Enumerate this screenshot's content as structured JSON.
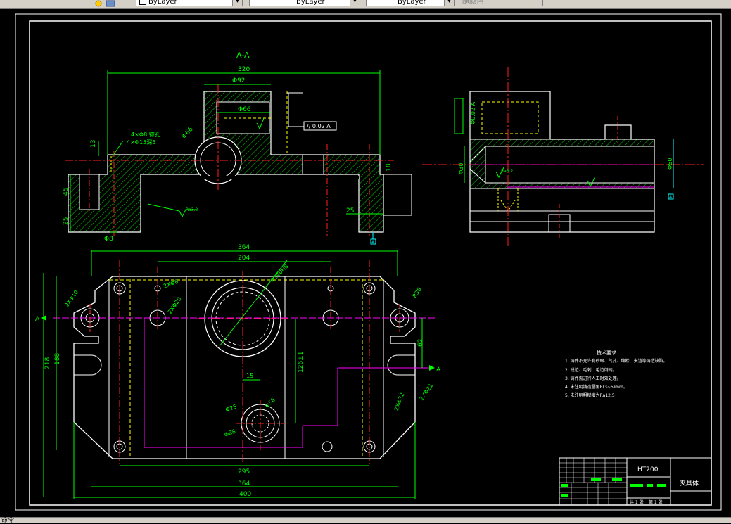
{
  "toolbar": {
    "layer_combo": "ByLayer",
    "linetype_combo": "ByLayer",
    "lineweight_combo": "ByLayer",
    "plotstyle_combo": "随颜色"
  },
  "drawing": {
    "section_title": "A-A",
    "section_marker": "A",
    "dims_top": {
      "d320": "320",
      "d92": "Φ92",
      "d66": "Φ66",
      "d66b": "Φ66",
      "d13": "13",
      "d45": "45",
      "d25a": "25",
      "d25b": "25",
      "d18": "18",
      "d8": "Φ8",
      "holes": "4×Φ8 锪孔",
      "holes2": "4×Φ15深5",
      "tol": "// 0.02 A",
      "rough": "Ra3.2"
    },
    "dims_plan": {
      "d364a": "364",
      "d204": "204",
      "d2x8": "2XΦ8",
      "d2x20": "2XΦ20",
      "d2x10": "2XΦ10",
      "d36": "R36",
      "d218": "218",
      "d188": "188",
      "d62": "62",
      "d126": "126±1",
      "d15": "15",
      "d25": "Φ25",
      "d56": "Φ56",
      "d88": "Φ88",
      "d2x32": "2XΦ32",
      "d2x21": "2XΦ21",
      "d295": "295",
      "d364b": "364",
      "d400": "400",
      "d140": "Φ140H8"
    },
    "dims_side": {
      "d30": "Φ30",
      "d50": "Φ50",
      "tol2": "Φ0.02 A",
      "rough": "Ra3.2"
    },
    "notes": {
      "heading": "技术要求",
      "lines": [
        "1. 铸件不允许有砂眼、气孔、缩松、夹渣等铸造缺陷。",
        "2. 锐边、毛刺、毛边倒钝。",
        "3. 铸件需进行人工时效处理。",
        "4. 未注明铸造圆角R(3~5)mm。",
        "5. 未注明粗糙度为Ra12.5"
      ]
    },
    "title_block": {
      "material": "HT200",
      "name": "夹具体",
      "sheet_total": "共 1 张",
      "sheet_no": "第 1 张"
    }
  },
  "status": {
    "command": "命令:"
  },
  "colors": {
    "background": "#000000",
    "frame": "#ffffff",
    "dimension": "#00ff00",
    "centerline": "#ff2020",
    "hidden": "#ffff00",
    "phantom": "#ff00ff",
    "datum": "#00ffff"
  }
}
